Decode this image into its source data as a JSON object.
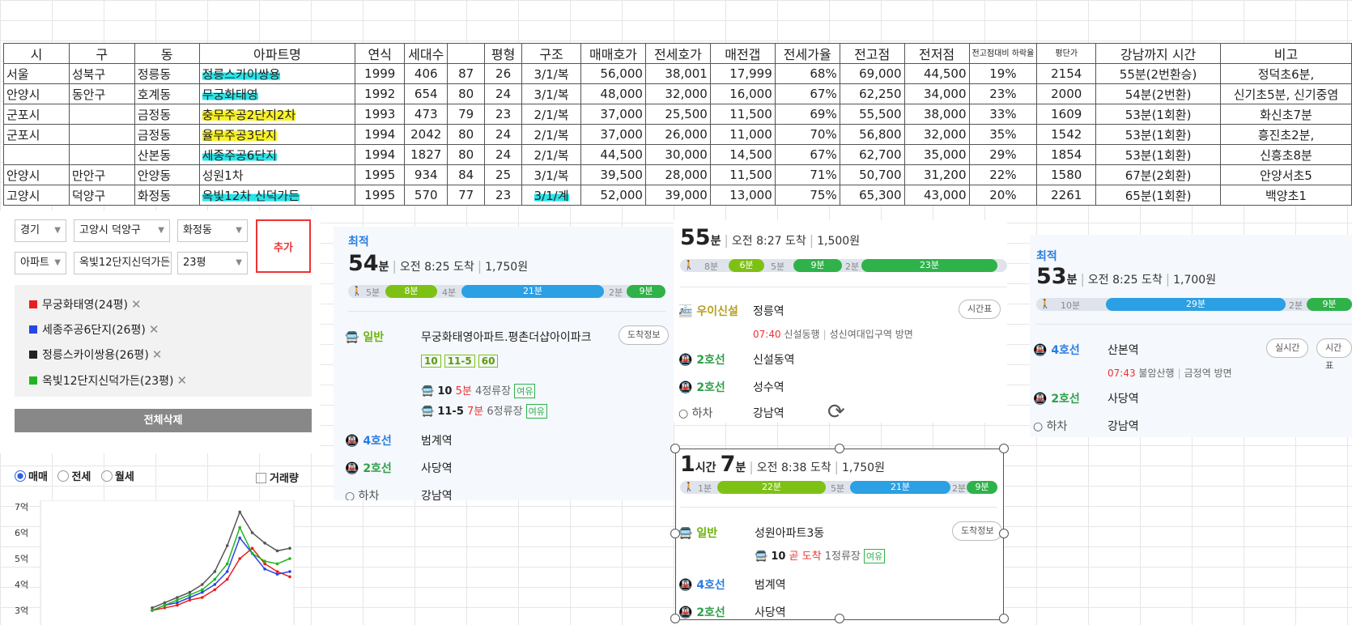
{
  "table": {
    "headers": [
      "시",
      "구",
      "동",
      "아파트명",
      "연식",
      "세대수",
      "",
      "평형",
      "구조",
      "매매호가",
      "전세호가",
      "매전갭",
      "전세가율",
      "전고점",
      "전저점",
      "전고점대비 하락율",
      "평단가",
      "강남까지 시간",
      "비고"
    ],
    "rows": [
      [
        "서울",
        "성북구",
        "정릉동",
        "정릉스카이쌍용",
        "1999",
        "406",
        "87",
        "26",
        "3/1/복",
        "56,000",
        "38,001",
        "17,999",
        "68%",
        "69,000",
        "44,500",
        "19%",
        "2154",
        "55분(2번환승)",
        "정덕초6분,"
      ],
      [
        "안양시",
        "동안구",
        "호계동",
        "무궁화태영",
        "1992",
        "654",
        "80",
        "24",
        "3/1/복",
        "48,000",
        "32,000",
        "16,000",
        "67%",
        "62,250",
        "34,000",
        "23%",
        "2000",
        "54분(2번환)",
        "신기초5분, 신기중염"
      ],
      [
        "군포시",
        "",
        "금정동",
        "충무주공2단지2차",
        "1993",
        "473",
        "79",
        "23",
        "2/1/복",
        "37,000",
        "25,500",
        "11,500",
        "69%",
        "55,500",
        "38,000",
        "33%",
        "1609",
        "53분(1회환)",
        "화신초7분"
      ],
      [
        "군포시",
        "",
        "금정동",
        "율무주공3단지",
        "1994",
        "2042",
        "80",
        "24",
        "2/1/복",
        "37,000",
        "26,000",
        "11,000",
        "70%",
        "56,800",
        "32,000",
        "35%",
        "1542",
        "53분(1회환)",
        "흥진초2분,"
      ],
      [
        "",
        "",
        "산본동",
        "세종주공6단지",
        "1994",
        "1827",
        "80",
        "24",
        "2/1/복",
        "44,500",
        "30,000",
        "14,500",
        "67%",
        "62,700",
        "35,000",
        "29%",
        "1854",
        "53분(1회환)",
        "신흥초8분"
      ],
      [
        "안양시",
        "만안구",
        "안양동",
        "성원1차",
        "1995",
        "934",
        "84",
        "25",
        "3/1/복",
        "39,500",
        "28,000",
        "11,500",
        "71%",
        "50,700",
        "31,200",
        "22%",
        "1580",
        "67분(2회환)",
        "안양서초5"
      ],
      [
        "고양시",
        "덕양구",
        "화정동",
        "옥빛12차 신덕가든",
        "1995",
        "570",
        "77",
        "23",
        "3/1/계",
        "52,000",
        "39,000",
        "13,000",
        "75%",
        "65,300",
        "43,000",
        "20%",
        "2261",
        "65분(1회환)",
        "백양초1"
      ]
    ]
  },
  "filter": {
    "province": "경기",
    "city": "고양시 덕양구",
    "dong": "화정동",
    "type": "아파트",
    "apt": "옥빛12단지신덕가든",
    "size": "23평",
    "add": "추가",
    "tags": [
      {
        "label": "무궁화태영(24평)",
        "color": "#e81f1f"
      },
      {
        "label": "세종주공6단지(26평)",
        "color": "#2746e6"
      },
      {
        "label": "정릉스카이쌍용(26평)",
        "color": "#222222"
      },
      {
        "label": "옥빛12단지신덕가든(23평)",
        "color": "#22b522"
      }
    ],
    "delete_all": "전체삭제",
    "radios": [
      "매매",
      "전세",
      "월세"
    ],
    "volume": "거래량"
  },
  "chart_data": {
    "type": "line",
    "y_ticks": [
      "7억",
      "6억",
      "5억",
      "4억",
      "3억"
    ],
    "ylim": [
      3,
      7
    ],
    "series": [
      {
        "color": "#e81f1f",
        "values": [
          3.0,
          3.1,
          3.2,
          3.4,
          3.5,
          3.8,
          4.2,
          5.0,
          5.4,
          4.8,
          4.5,
          4.3
        ]
      },
      {
        "color": "#2746e6",
        "values": [
          3.0,
          3.2,
          3.3,
          3.5,
          3.7,
          4.0,
          4.5,
          5.8,
          5.2,
          4.6,
          4.4,
          4.5
        ]
      },
      {
        "color": "#555555",
        "values": [
          3.1,
          3.3,
          3.5,
          3.7,
          4.0,
          4.5,
          5.5,
          6.8,
          6.0,
          5.6,
          5.3,
          5.4
        ]
      },
      {
        "color": "#22b522",
        "values": [
          3.0,
          3.2,
          3.4,
          3.6,
          3.8,
          4.2,
          4.8,
          6.2,
          5.2,
          4.9,
          4.8,
          5.0
        ]
      }
    ]
  },
  "route1": {
    "best": "최적",
    "minutes": "54",
    "min_unit": "분",
    "arrive": "오전 8:25 도착",
    "fare": "1,750원",
    "segs": [
      "5분",
      "8분",
      "4분",
      "21분",
      "2분",
      "9분"
    ],
    "m1": "일반",
    "s1": "무궁화태영아파트.평촌더샵아이파크",
    "btn1": "도착정보",
    "buses": [
      "10",
      "11-5",
      "60"
    ],
    "b1": "10",
    "b1t": "5분",
    "b1s": "4정류장",
    "b2": "11-5",
    "b2t": "7분",
    "b2s": "6정류장",
    "ok": "여유",
    "m2": "4호선",
    "s2": "범계역",
    "m3": "2호선",
    "s3": "사당역",
    "m4": "하차",
    "s4": "강남역"
  },
  "route2": {
    "minutes": "55",
    "min_unit": "분",
    "arrive": "오전 8:27 도착",
    "fare": "1,500원",
    "segs": [
      "8분",
      "6분",
      "5분",
      "9분",
      "2분",
      "23분"
    ],
    "m1": "우이신설",
    "s1": "정릉역",
    "btn1": "시간표",
    "n1t": "07:40",
    "n1": "신설동행",
    "n1b": "성신여대입구역 방면",
    "m2": "2호선",
    "s2": "신설동역",
    "m3": "2호선",
    "s3": "성수역",
    "m4": "하차",
    "s4": "강남역"
  },
  "route3": {
    "hours": "1",
    "hour_unit": "시간",
    "minutes": "7",
    "min_unit": "분",
    "arrive": "오전 8:38 도착",
    "fare": "1,750원",
    "segs": [
      "1분",
      "22분",
      "5분",
      "21분",
      "2분",
      "9분"
    ],
    "m1": "일반",
    "s1": "성원아파트3동",
    "btn1": "도착정보",
    "b1": "10",
    "b1t": "곧 도착",
    "b1s": "1정류장",
    "ok": "여유",
    "m2": "4호선",
    "s2": "범계역",
    "m3": "2호선",
    "s3": "사당역"
  },
  "route4": {
    "best": "최적",
    "minutes": "53",
    "min_unit": "분",
    "arrive": "오전 8:25 도착",
    "fare": "1,700원",
    "segs": [
      "10분",
      "29분",
      "2분",
      "9분"
    ],
    "m1": "4호선",
    "s1": "산본역",
    "btn1": "실시간",
    "btn2": "시간표",
    "n1t": "07:43",
    "n1": "불암산행",
    "n1b": "금정역 방면",
    "m2": "2호선",
    "s2": "사당역",
    "m3": "하차",
    "s3": "강남역"
  }
}
